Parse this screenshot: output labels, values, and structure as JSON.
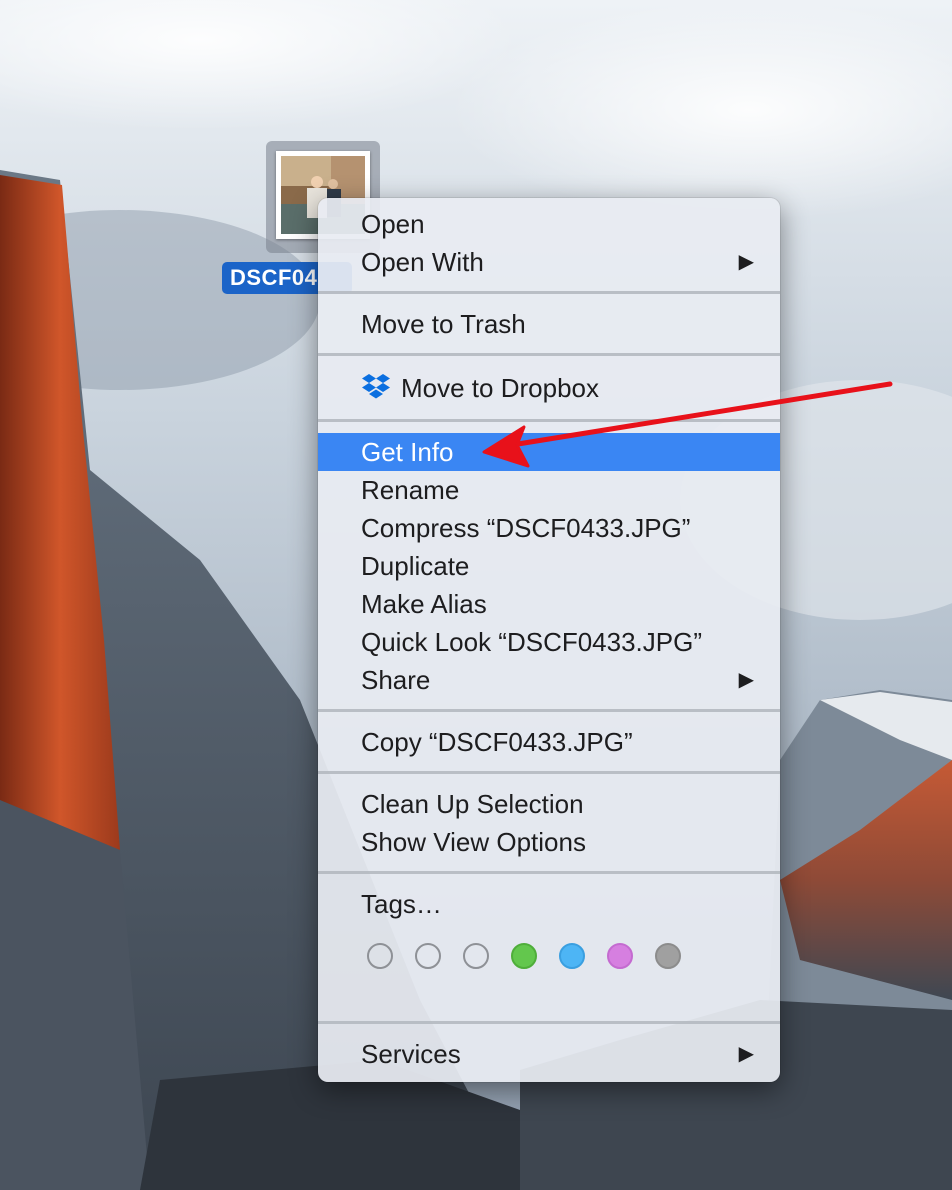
{
  "file": {
    "label": "DSCF0433.JPG",
    "visible_label": "DSCF04"
  },
  "menu": {
    "open": "Open",
    "open_with": "Open With",
    "move_to_trash": "Move to Trash",
    "move_to_dropbox": "Move to Dropbox",
    "get_info": "Get Info",
    "rename": "Rename",
    "compress": "Compress “DSCF0433.JPG”",
    "duplicate": "Duplicate",
    "make_alias": "Make Alias",
    "quick_look": "Quick Look “DSCF0433.JPG”",
    "share": "Share",
    "copy": "Copy “DSCF0433.JPG”",
    "clean_up_selection": "Clean Up Selection",
    "show_view_options": "Show View Options",
    "tags": "Tags…",
    "services": "Services",
    "submenu_arrow": "▶"
  },
  "tag_colors": [
    {
      "name": "none-1",
      "fill": "transparent",
      "border": "#8e9196"
    },
    {
      "name": "none-2",
      "fill": "transparent",
      "border": "#8e9196"
    },
    {
      "name": "none-3",
      "fill": "transparent",
      "border": "#8e9196"
    },
    {
      "name": "green",
      "fill": "#63c74d",
      "border": "#4fae3a"
    },
    {
      "name": "blue",
      "fill": "#4db5f5",
      "border": "#3a9fe0"
    },
    {
      "name": "purple",
      "fill": "#d67fe0",
      "border": "#c46bd0"
    },
    {
      "name": "gray",
      "fill": "#a0a0a0",
      "border": "#8c8c8c"
    }
  ],
  "colors": {
    "highlight": "#3a86f3",
    "selection_label": "#1b64c8",
    "annotation_arrow": "#e8111a",
    "dropbox": "#0b6fe0"
  },
  "icons": {
    "dropbox": "dropbox-icon",
    "submenu": "chevron-right-icon",
    "annotation": "red-arrow-annotation"
  }
}
